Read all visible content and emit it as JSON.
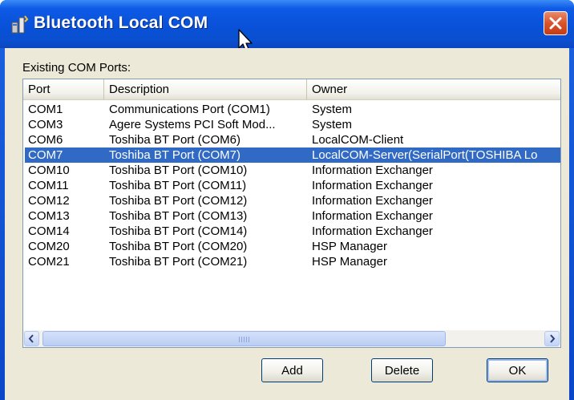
{
  "window": {
    "title": "Bluetooth Local COM",
    "close_symbol": "✕",
    "app_icon": "bluetooth-com-app-icon"
  },
  "group": {
    "label": "Existing COM Ports:"
  },
  "table": {
    "columns": [
      "Port",
      "Description",
      "Owner"
    ],
    "selected_index": 3,
    "rows": [
      {
        "port": "COM1",
        "description": "Communications Port (COM1)",
        "owner": "System"
      },
      {
        "port": "COM3",
        "description": "Agere Systems PCI Soft Mod...",
        "owner": "System"
      },
      {
        "port": "COM6",
        "description": "Toshiba BT Port (COM6)",
        "owner": "LocalCOM-Client"
      },
      {
        "port": "COM7",
        "description": "Toshiba BT Port (COM7)",
        "owner": "LocalCOM-Server(SerialPort(TOSHIBA Lo"
      },
      {
        "port": "COM10",
        "description": "Toshiba BT Port (COM10)",
        "owner": "Information Exchanger"
      },
      {
        "port": "COM11",
        "description": "Toshiba BT Port (COM11)",
        "owner": "Information Exchanger"
      },
      {
        "port": "COM12",
        "description": "Toshiba BT Port (COM12)",
        "owner": "Information Exchanger"
      },
      {
        "port": "COM13",
        "description": "Toshiba BT Port (COM13)",
        "owner": "Information Exchanger"
      },
      {
        "port": "COM14",
        "description": "Toshiba BT Port (COM14)",
        "owner": "Information Exchanger"
      },
      {
        "port": "COM20",
        "description": "Toshiba BT Port (COM20)",
        "owner": "HSP Manager"
      },
      {
        "port": "COM21",
        "description": "Toshiba BT Port (COM21)",
        "owner": "HSP Manager"
      }
    ]
  },
  "buttons": {
    "add": "Add",
    "delete": "Delete",
    "ok": "OK"
  },
  "colors": {
    "titlebar": "#0a4fcf",
    "selection": "#316ac5",
    "dialog_bg": "#ece9d8",
    "close_button": "#d9542b"
  }
}
